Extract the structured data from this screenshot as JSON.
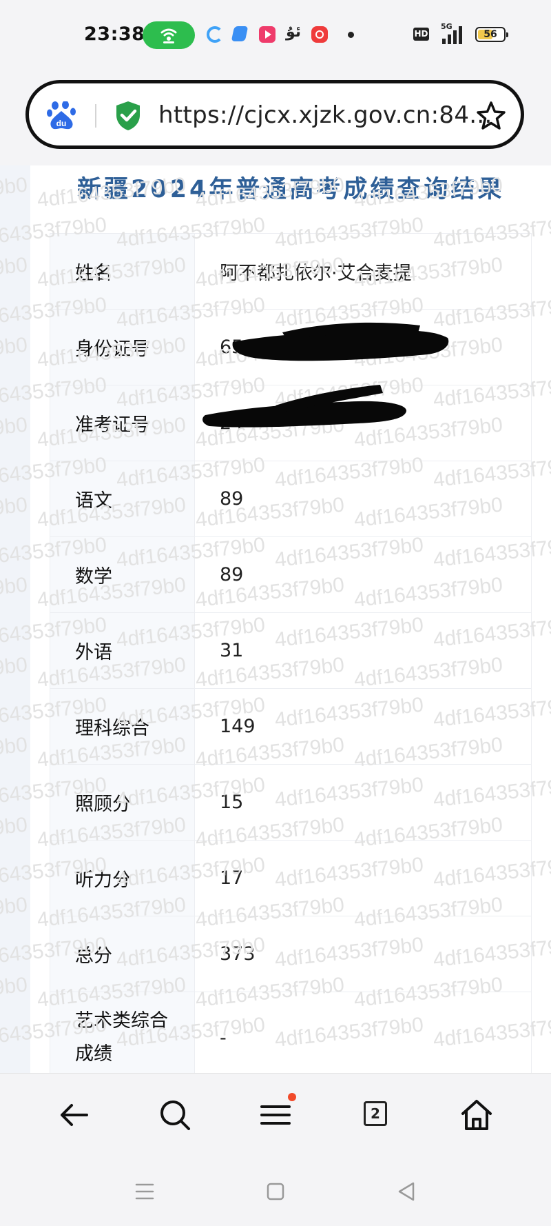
{
  "status_bar": {
    "time": "23:38",
    "hd_badge": "HD",
    "network": "5G",
    "battery": "56",
    "battery_level": 0.56,
    "icons": [
      "hotspot-icon",
      "browser-app-icon",
      "app-icon",
      "video-app-icon",
      "uyghur-app-icon",
      "music-app-icon",
      "more-dot-icon",
      "hd-icon",
      "signal-icon",
      "battery-icon"
    ]
  },
  "address_bar": {
    "url": "https://cjcx.xjzk.gov.cn:84...",
    "icons": [
      "baidu-icon",
      "security-shield-icon",
      "bookmark-star-icon"
    ]
  },
  "page": {
    "title": "新疆2024年普通高考成绩查询结果",
    "watermark_text": "4df164353f79b0",
    "rows": [
      {
        "label": "姓名",
        "value": "阿不都扎依尔·艾合麦提"
      },
      {
        "label": "身份证号",
        "value": "65"
      },
      {
        "label": "准考证号",
        "value": "24"
      },
      {
        "label": "语文",
        "value": "89"
      },
      {
        "label": "数学",
        "value": "89"
      },
      {
        "label": "外语",
        "value": "31"
      },
      {
        "label": "理科综合",
        "value": "149"
      },
      {
        "label": "照顾分",
        "value": "15"
      },
      {
        "label": "听力分",
        "value": "17"
      },
      {
        "label": "总分",
        "value": "373"
      },
      {
        "label": "艺术类综合成绩",
        "value": "-"
      }
    ]
  },
  "toolbar": {
    "tab_count": "2",
    "icons": [
      "back-arrow-icon",
      "search-icon",
      "menu-icon",
      "tabs-icon",
      "home-icon"
    ]
  },
  "system_nav": {
    "icons": [
      "recents-icon",
      "home-button-icon",
      "back-triangle-icon"
    ]
  },
  "colors": {
    "title": "#2e5f97",
    "hotspot": "#2dbd4e",
    "shield": "#2aa04a",
    "notification_dot": "#f14a2a",
    "battery_fill": "#f2c94c"
  }
}
